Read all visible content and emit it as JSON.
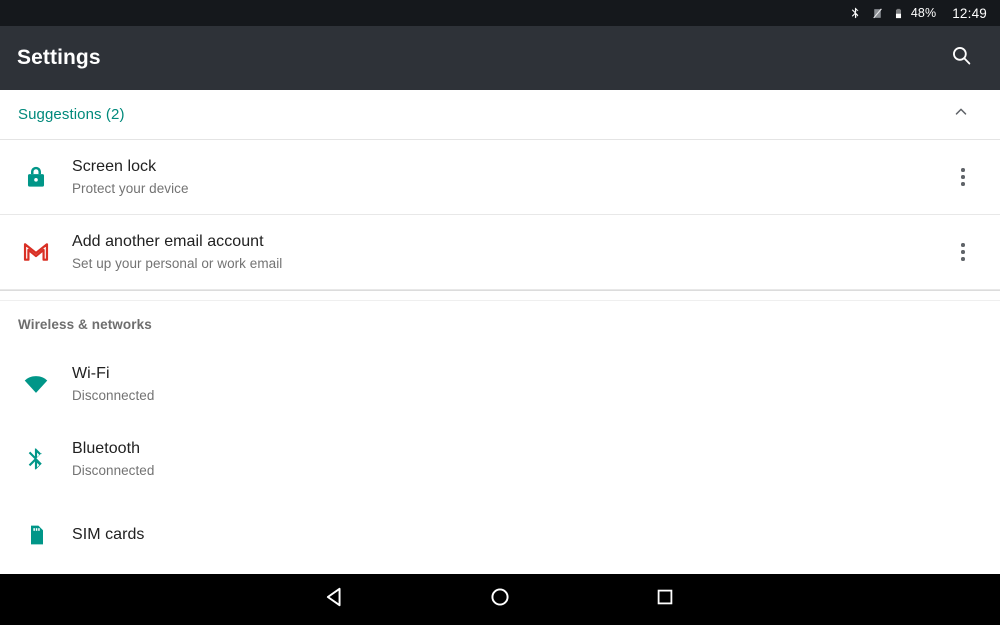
{
  "status_bar": {
    "bluetooth_icon": "bluetooth-icon",
    "signal_off_icon": "signal-off-icon",
    "battery_icon": "battery-icon",
    "battery_percent": "48%",
    "time": "12:49"
  },
  "toolbar": {
    "title": "Settings",
    "search_icon": "search-icon"
  },
  "suggestions": {
    "header_label": "Suggestions (2)",
    "collapse_icon": "chevron-up-icon",
    "accent_color": "#00897b",
    "items": [
      {
        "icon": "lock-icon",
        "title": "Screen lock",
        "subtitle": "Protect your device",
        "overflow_icon": "more-vert-icon"
      },
      {
        "icon": "gmail-icon",
        "title": "Add another email account",
        "subtitle": "Set up your personal or work email",
        "overflow_icon": "more-vert-icon"
      }
    ]
  },
  "sections": [
    {
      "header": "Wireless & networks",
      "items": [
        {
          "icon": "wifi-icon",
          "title": "Wi-Fi",
          "subtitle": "Disconnected"
        },
        {
          "icon": "bluetooth-icon",
          "title": "Bluetooth",
          "subtitle": "Disconnected"
        },
        {
          "icon": "sim-card-icon",
          "title": "SIM cards",
          "subtitle": ""
        }
      ]
    }
  ],
  "nav_bar": {
    "back_icon": "back-triangle-icon",
    "home_icon": "home-circle-icon",
    "recents_icon": "recents-square-icon"
  },
  "colors": {
    "status_bar_bg": "#15181c",
    "toolbar_bg": "#2e3238",
    "accent_teal": "#009688",
    "gmail_red": "#d93025",
    "nav_bar_bg": "#000000"
  }
}
